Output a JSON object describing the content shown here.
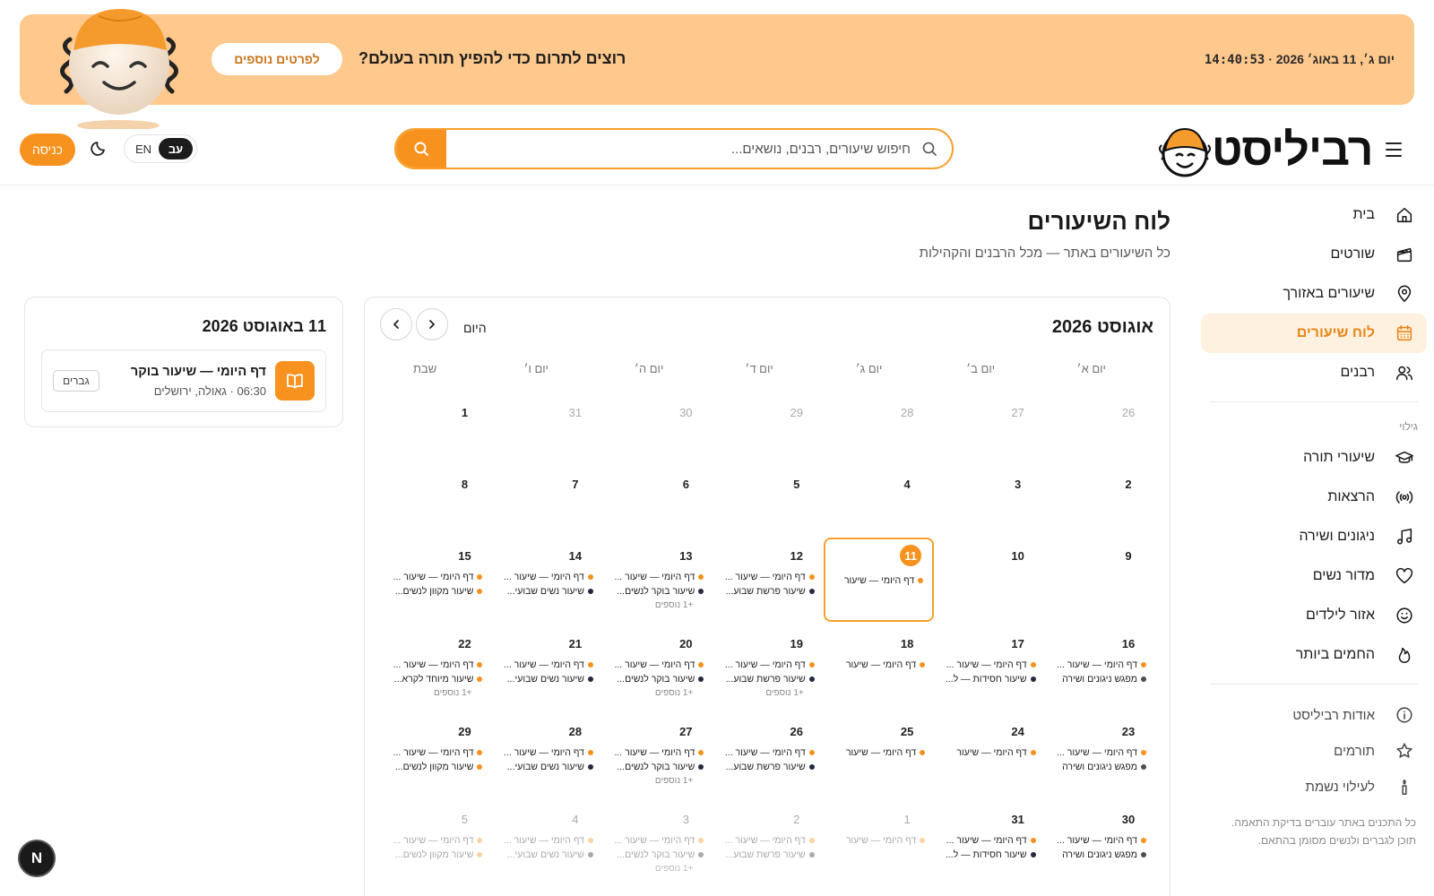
{
  "banner": {
    "date": "יום ג׳, 11 באוג׳ 2026",
    "separator": "·",
    "time": "14:40:53",
    "message": "רוצים לתרום כדי להפיץ תורה בעולם?",
    "button": "לפרטים נוספים"
  },
  "header": {
    "logo": "רביליסט",
    "search_placeholder": "חיפוש שיעורים, רבנים, נושאים...",
    "lang_he": "עב",
    "lang_en": "EN",
    "login": "כניסה"
  },
  "sidebar": {
    "main": [
      {
        "label": "בית",
        "icon": "home-icon"
      },
      {
        "label": "שורטים",
        "icon": "clapperboard-icon"
      },
      {
        "label": "שיעורים באזורך",
        "icon": "map-pin-icon"
      },
      {
        "label": "לוח שיעורים",
        "icon": "calendar-icon",
        "active": true
      },
      {
        "label": "רבנים",
        "icon": "users-icon"
      }
    ],
    "section_label": "גילוי",
    "discover": [
      {
        "label": "שיעורי תורה",
        "icon": "graduation-cap-icon"
      },
      {
        "label": "הרצאות",
        "icon": "broadcast-icon"
      },
      {
        "label": "ניגונים ושירה",
        "icon": "music-icon"
      },
      {
        "label": "מדור נשים",
        "icon": "heart-icon"
      },
      {
        "label": "אזור לילדים",
        "icon": "smile-icon"
      },
      {
        "label": "החמים ביותר",
        "icon": "flame-icon"
      }
    ],
    "footer": [
      {
        "label": "אודות רביליסט",
        "icon": "info-icon"
      },
      {
        "label": "תורמים",
        "icon": "star-icon"
      },
      {
        "label": "לעילוי נשמת",
        "icon": "candle-icon"
      }
    ],
    "note_line1": "כל התכנים באתר עוברים בדיקת התאמה.",
    "note_line2": "תוכן לגברים ולנשים מסומן בהתאם."
  },
  "page": {
    "title": "לוח השיעורים",
    "subtitle": "כל השיעורים באתר — מכל הרבנים והקהילות"
  },
  "calendar": {
    "month": "אוגוסט 2026",
    "today_label": "היום",
    "weekdays": [
      "יום א׳",
      "יום ב׳",
      "יום ג׳",
      "יום ד׳",
      "יום ה׳",
      "יום ו׳",
      "שבת"
    ],
    "weeks": [
      {
        "height": 80,
        "days": [
          {
            "n": "26",
            "other": true
          },
          {
            "n": "27",
            "other": true
          },
          {
            "n": "28",
            "other": true
          },
          {
            "n": "29",
            "other": true
          },
          {
            "n": "30",
            "other": true
          },
          {
            "n": "31",
            "other": true
          },
          {
            "n": "1"
          }
        ]
      },
      {
        "height": 80,
        "days": [
          {
            "n": "2"
          },
          {
            "n": "3"
          },
          {
            "n": "4"
          },
          {
            "n": "5"
          },
          {
            "n": "6"
          },
          {
            "n": "7"
          },
          {
            "n": "8"
          }
        ]
      },
      {
        "height": 98,
        "days": [
          {
            "n": "9"
          },
          {
            "n": "10"
          },
          {
            "n": "11",
            "today": true,
            "events": [
              {
                "c": "orange",
                "t": "דף היומי — שיעור"
              }
            ]
          },
          {
            "n": "12",
            "events": [
              {
                "c": "orange",
                "t": "דף היומי — שיעור ..."
              },
              {
                "c": "navy",
                "t": "שיעור פרשת שבוע..."
              }
            ]
          },
          {
            "n": "13",
            "events": [
              {
                "c": "orange",
                "t": "דף היומי — שיעור ..."
              },
              {
                "c": "navy",
                "t": "שיעור בוקר לנשים..."
              }
            ],
            "more": "+1 נוספים"
          },
          {
            "n": "14",
            "events": [
              {
                "c": "orange",
                "t": "דף היומי — שיעור ..."
              },
              {
                "c": "navy",
                "t": "שיעור נשים שבועי..."
              }
            ]
          },
          {
            "n": "15",
            "events": [
              {
                "c": "orange",
                "t": "דף היומי — שיעור ..."
              },
              {
                "c": "orange",
                "t": "שיעור מקוון לנשים..."
              }
            ]
          }
        ]
      },
      {
        "height": 98,
        "days": [
          {
            "n": "16",
            "events": [
              {
                "c": "orange",
                "t": "דף היומי — שיעור ..."
              },
              {
                "c": "gray",
                "t": "מפגש ניגונים ושירה"
              }
            ]
          },
          {
            "n": "17",
            "events": [
              {
                "c": "orange",
                "t": "דף היומי — שיעור ..."
              },
              {
                "c": "navy",
                "t": "שיעור חסידות — ל..."
              }
            ]
          },
          {
            "n": "18",
            "events": [
              {
                "c": "orange",
                "t": "דף היומי — שיעור"
              }
            ]
          },
          {
            "n": "19",
            "events": [
              {
                "c": "orange",
                "t": "דף היומי — שיעור ..."
              },
              {
                "c": "navy",
                "t": "שיעור פרשת שבוע..."
              }
            ],
            "more": "+1 נוספים"
          },
          {
            "n": "20",
            "events": [
              {
                "c": "orange",
                "t": "דף היומי — שיעור ..."
              },
              {
                "c": "navy",
                "t": "שיעור בוקר לנשים..."
              }
            ],
            "more": "+1 נוספים"
          },
          {
            "n": "21",
            "events": [
              {
                "c": "orange",
                "t": "דף היומי — שיעור ..."
              },
              {
                "c": "navy",
                "t": "שיעור נשים שבועי..."
              }
            ]
          },
          {
            "n": "22",
            "events": [
              {
                "c": "orange",
                "t": "דף היומי — שיעור ..."
              },
              {
                "c": "orange",
                "t": "שיעור מיוחד לקרא..."
              }
            ],
            "more": "+1 נוספים"
          }
        ]
      },
      {
        "height": 98,
        "days": [
          {
            "n": "23",
            "events": [
              {
                "c": "orange",
                "t": "דף היומי — שיעור ..."
              },
              {
                "c": "gray",
                "t": "מפגש ניגונים ושירה"
              }
            ]
          },
          {
            "n": "24",
            "events": [
              {
                "c": "orange",
                "t": "דף היומי — שיעור"
              }
            ]
          },
          {
            "n": "25",
            "events": [
              {
                "c": "orange",
                "t": "דף היומי — שיעור"
              }
            ]
          },
          {
            "n": "26",
            "events": [
              {
                "c": "orange",
                "t": "דף היומי — שיעור ..."
              },
              {
                "c": "navy",
                "t": "שיעור פרשת שבוע..."
              }
            ]
          },
          {
            "n": "27",
            "events": [
              {
                "c": "orange",
                "t": "דף היומי — שיעור ..."
              },
              {
                "c": "navy",
                "t": "שיעור בוקר לנשים..."
              }
            ],
            "more": "+1 נוספים"
          },
          {
            "n": "28",
            "events": [
              {
                "c": "orange",
                "t": "דף היומי — שיעור ..."
              },
              {
                "c": "navy",
                "t": "שיעור נשים שבועי..."
              }
            ]
          },
          {
            "n": "29",
            "events": [
              {
                "c": "orange",
                "t": "דף היומי — שיעור ..."
              },
              {
                "c": "orange",
                "t": "שיעור מקוון לנשים..."
              }
            ]
          }
        ]
      },
      {
        "height": 98,
        "days": [
          {
            "n": "30",
            "events": [
              {
                "c": "orange",
                "t": "דף היומי — שיעור ..."
              },
              {
                "c": "gray",
                "t": "מפגש ניגונים ושירה"
              }
            ]
          },
          {
            "n": "31",
            "events": [
              {
                "c": "orange",
                "t": "דף היומי — שיעור ..."
              },
              {
                "c": "navy",
                "t": "שיעור חסידות — ל..."
              }
            ]
          },
          {
            "n": "1",
            "faded": true,
            "events": [
              {
                "c": "orange",
                "t": "דף היומי — שיעור"
              }
            ]
          },
          {
            "n": "2",
            "faded": true,
            "events": [
              {
                "c": "orange",
                "t": "דף היומי — שיעור ..."
              },
              {
                "c": "navy",
                "t": "שיעור פרשת שבוע..."
              }
            ]
          },
          {
            "n": "3",
            "faded": true,
            "events": [
              {
                "c": "orange",
                "t": "דף היומי — שיעור ..."
              },
              {
                "c": "navy",
                "t": "שיעור בוקר לנשים..."
              }
            ],
            "more": "+1 נוספים"
          },
          {
            "n": "4",
            "faded": true,
            "events": [
              {
                "c": "orange",
                "t": "דף היומי — שיעור ..."
              },
              {
                "c": "navy",
                "t": "שיעור נשים שבועי..."
              }
            ]
          },
          {
            "n": "5",
            "faded": true,
            "events": [
              {
                "c": "orange",
                "t": "דף היומי — שיעור ..."
              },
              {
                "c": "orange",
                "t": "שיעור מקוון לנשים..."
              }
            ]
          }
        ]
      }
    ]
  },
  "day_panel": {
    "title": "11 באוגוסט 2026",
    "lesson": {
      "title": "דף היומי — שיעור בוקר",
      "time": "06:30",
      "location": "גאולה, ירושלים",
      "tag": "גברים"
    }
  },
  "badge": "N",
  "colors": {
    "accent": "#f7921e",
    "banner_bg": "#ffc88c",
    "active_bg": "#fff1e0",
    "event_navy": "#222a44"
  }
}
